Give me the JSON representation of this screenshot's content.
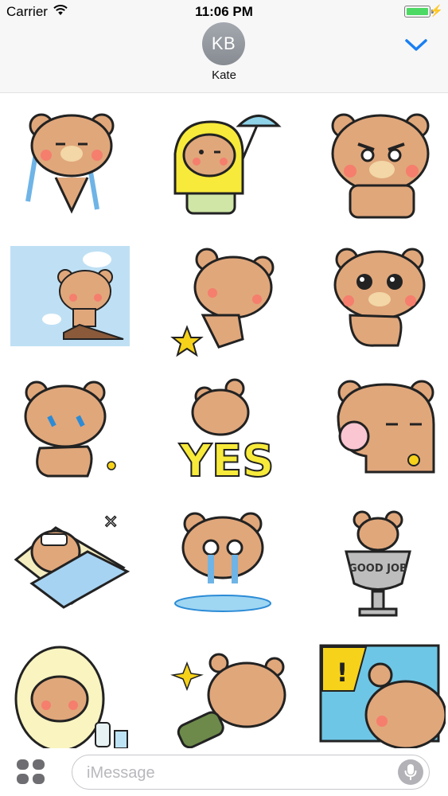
{
  "status_bar": {
    "carrier": "Carrier",
    "time": "11:06 PM",
    "battery_level": 1.0,
    "charging_symbol": "⚡"
  },
  "header": {
    "avatar_initials": "KB",
    "contact_name": "Kate",
    "collapse_icon": "chevron-down-icon",
    "accent_color": "#1a7ff2"
  },
  "stickers": [
    {
      "name": "crying bear"
    },
    {
      "name": "raincoat bear with umbrella"
    },
    {
      "name": "angry bear thumbs up"
    },
    {
      "name": "bear on cliff"
    },
    {
      "name": "bear kicking star"
    },
    {
      "name": "wide-eyed bear"
    },
    {
      "name": "sobbing bear"
    },
    {
      "name": "yes bear",
      "text": "YES"
    },
    {
      "name": "sleepy bear with mochi"
    },
    {
      "name": "sick bear in bed"
    },
    {
      "name": "shocked crying bear"
    },
    {
      "name": "trophy bear",
      "text": "GOOD JOB"
    },
    {
      "name": "bear in fluffy hood"
    },
    {
      "name": "sparkle bear with sleeping bag"
    },
    {
      "name": "surprised bear comic panel",
      "text": "!"
    }
  ],
  "composer": {
    "placeholder": "iMessage",
    "apps_icon": "app-drawer-icon",
    "mic_icon": "microphone-icon"
  }
}
